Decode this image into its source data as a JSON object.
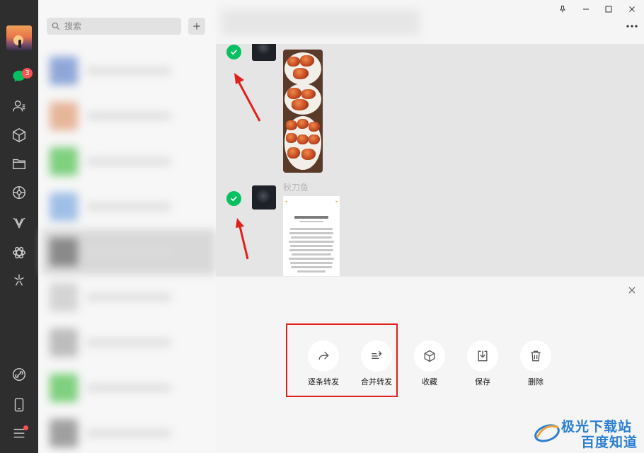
{
  "sidebar": {
    "unread_badge": "3",
    "icons": [
      "chat-icon",
      "contacts-icon",
      "favorites-icon",
      "files-icon",
      "moments-icon",
      "channels-icon",
      "search-network-icon",
      "mini-programs-icon",
      "link-icon",
      "phone-icon",
      "menu-icon"
    ]
  },
  "search": {
    "placeholder": "搜索"
  },
  "chat": {
    "messages": [
      {
        "type": "image",
        "selected": true
      },
      {
        "type": "document",
        "sender": "秋刀鱼",
        "selected": true
      }
    ]
  },
  "actions": [
    {
      "id": "forward-one-by-one",
      "label": "逐条转发",
      "icon": "forward-icon"
    },
    {
      "id": "merge-forward",
      "label": "合并转发",
      "icon": "merge-forward-icon"
    },
    {
      "id": "favorite",
      "label": "收藏",
      "icon": "cube-icon"
    },
    {
      "id": "save",
      "label": "保存",
      "icon": "download-icon"
    },
    {
      "id": "delete",
      "label": "删除",
      "icon": "trash-icon"
    }
  ],
  "watermark": {
    "line1": "极光下载站",
    "line2": "百度知道"
  },
  "colors": {
    "check_green": "#07c160",
    "badge_red": "#fa5151",
    "highlight_red": "#e0201b"
  }
}
